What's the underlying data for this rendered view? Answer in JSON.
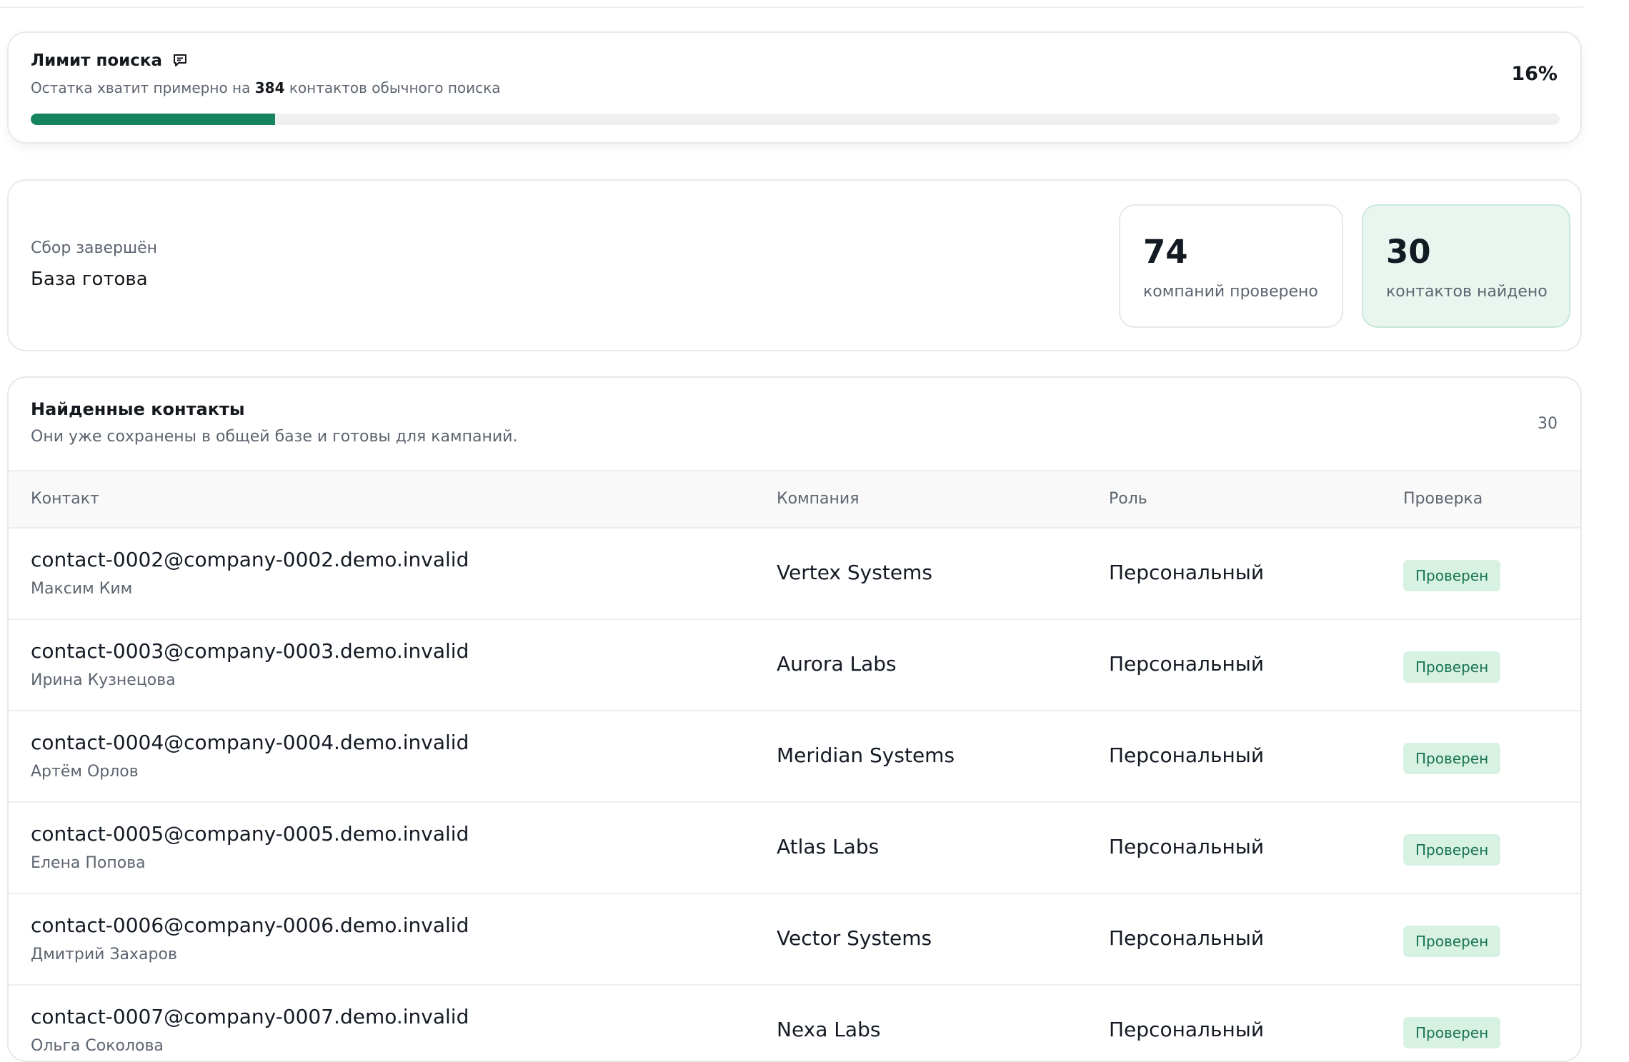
{
  "limit": {
    "title": "Лимит поиска",
    "comment_icon": "message-icon",
    "subtitle_before": "Остатка хватит примерно на ",
    "subtitle_count": "384",
    "subtitle_after": " контактов обычного поиска",
    "percent_label": "16%",
    "progress_fraction": 0.16,
    "accent_color": "#17845e"
  },
  "status": {
    "label": "Сбор завершён",
    "title": "База готова",
    "companies_count": "74",
    "companies_label": "компаний проверено",
    "contacts_count": "30",
    "contacts_label": "контактов найдено"
  },
  "contacts": {
    "title": "Найденные контакты",
    "subtitle": "Они уже сохранены в общей базе и готовы для кампаний.",
    "count": "30",
    "columns": [
      "Контакт",
      "Компания",
      "Роль",
      "Проверка"
    ],
    "rows": [
      {
        "email": "contact-0002@company-0002.demo.invalid",
        "name": "Максим Ким",
        "company": "Vertex Systems",
        "role": "Персональный",
        "status": "Проверен"
      },
      {
        "email": "contact-0003@company-0003.demo.invalid",
        "name": "Ирина Кузнецова",
        "company": "Aurora Labs",
        "role": "Персональный",
        "status": "Проверен"
      },
      {
        "email": "contact-0004@company-0004.demo.invalid",
        "name": "Артём Орлов",
        "company": "Meridian Systems",
        "role": "Персональный",
        "status": "Проверен"
      },
      {
        "email": "contact-0005@company-0005.demo.invalid",
        "name": "Елена Попова",
        "company": "Atlas Labs",
        "role": "Персональный",
        "status": "Проверен"
      },
      {
        "email": "contact-0006@company-0006.demo.invalid",
        "name": "Дмитрий Захаров",
        "company": "Vector Systems",
        "role": "Персональный",
        "status": "Проверен"
      },
      {
        "email": "contact-0007@company-0007.demo.invalid",
        "name": "Ольга Соколова",
        "company": "Nexa Labs",
        "role": "Персональный",
        "status": "Проверен"
      }
    ]
  }
}
